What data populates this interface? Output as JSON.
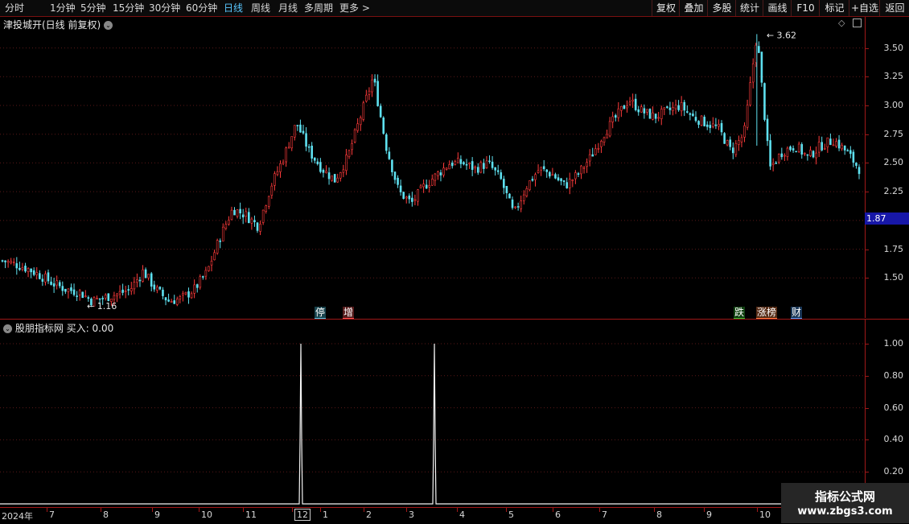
{
  "toolbar": {
    "timeframes": [
      "分时",
      "1分钟",
      "5分钟",
      "15分钟",
      "30分钟",
      "60分钟",
      "日线",
      "周线",
      "月线",
      "多周期",
      "更多 >"
    ],
    "active_timeframe": "日线",
    "right_buttons": [
      "复权",
      "叠加",
      "多股",
      "统计",
      "画线",
      "F10",
      "标记",
      "+自选",
      "返回"
    ]
  },
  "main_chart": {
    "title": "津投城开(日线 前复权)",
    "current_price": "1.87",
    "y_ticks": [
      "3.50",
      "3.25",
      "3.00",
      "2.75",
      "2.50",
      "2.25",
      "2.00",
      "1.75",
      "1.50"
    ],
    "high_label": "3.62",
    "low_label": "1.16",
    "badges": [
      {
        "text": "停",
        "color": "#48c8e8"
      },
      {
        "text": "增",
        "color": "#ff5050"
      },
      {
        "text": "跌",
        "color": "#30c030"
      },
      {
        "text": "涨榜",
        "color": "#ff8040"
      },
      {
        "text": "财",
        "color": "#48a0ff"
      }
    ]
  },
  "sub_chart": {
    "title": "股朋指标网 买入: 0.00",
    "y_ticks": [
      "1.00",
      "0.80",
      "0.60",
      "0.40",
      "0.20"
    ]
  },
  "x_axis": {
    "labels": [
      "2024年",
      "7",
      "8",
      "9",
      "10",
      "11",
      "12",
      "1",
      "2",
      "3",
      "4",
      "5",
      "6",
      "7",
      "8",
      "9",
      "10",
      "11"
    ],
    "highlighted": "12"
  },
  "watermark": {
    "line1": "指标公式网",
    "line2": "www.zbgs3.com"
  },
  "chart_data": [
    {
      "type": "candlestick",
      "title": "津投城开(日线 前复权)",
      "ylim": [
        1.25,
        3.7
      ],
      "y_ticks": [
        1.5,
        1.75,
        2.0,
        2.25,
        2.5,
        2.75,
        3.0,
        3.25,
        3.5
      ],
      "annotations": {
        "high": 3.62,
        "low": 1.16,
        "current": 1.87
      },
      "x_months": [
        "2024年",
        "7",
        "8",
        "9",
        "10",
        "11",
        "12",
        "1",
        "2",
        "3",
        "4",
        "5",
        "6",
        "7",
        "8",
        "9",
        "10",
        "11"
      ],
      "close_approx": [
        1.65,
        1.62,
        1.58,
        1.52,
        1.45,
        1.4,
        1.38,
        1.3,
        1.33,
        1.36,
        1.4,
        1.56,
        1.4,
        1.3,
        1.32,
        1.4,
        1.55,
        1.85,
        2.1,
        2.05,
        1.95,
        2.3,
        2.55,
        2.85,
        2.6,
        2.45,
        2.35,
        2.55,
        2.9,
        3.25,
        2.65,
        2.25,
        2.15,
        2.3,
        2.4,
        2.5,
        2.5,
        2.45,
        2.5,
        2.35,
        2.05,
        2.3,
        2.45,
        2.4,
        2.3,
        2.4,
        2.55,
        2.75,
        2.9,
        3.05,
        2.95,
        2.9,
        2.95,
        3.0,
        2.9,
        2.85,
        2.8,
        2.6,
        2.75,
        3.62,
        2.45,
        2.6,
        2.65,
        2.55,
        2.65,
        2.7,
        2.6,
        2.45
      ],
      "interval_days": 5
    },
    {
      "type": "line",
      "title": "股朋指标网 买入",
      "ylim": [
        0,
        1.05
      ],
      "y_ticks": [
        0.2,
        0.4,
        0.6,
        0.8,
        1.0
      ],
      "series": [
        {
          "name": "买入",
          "spikes_at_x_month": [
            "12",
            "3"
          ],
          "spike_value": 1.0,
          "base_value": 0.0
        }
      ],
      "current_value": 0.0
    }
  ]
}
